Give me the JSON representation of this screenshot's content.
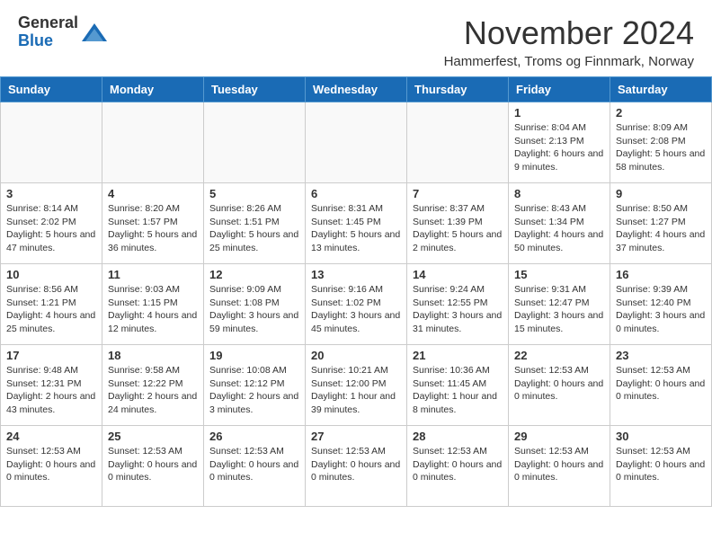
{
  "logo": {
    "general": "General",
    "blue": "Blue"
  },
  "title": "November 2024",
  "location": "Hammerfest, Troms og Finnmark, Norway",
  "headers": [
    "Sunday",
    "Monday",
    "Tuesday",
    "Wednesday",
    "Thursday",
    "Friday",
    "Saturday"
  ],
  "weeks": [
    [
      {
        "day": "",
        "info": "",
        "empty": true
      },
      {
        "day": "",
        "info": "",
        "empty": true
      },
      {
        "day": "",
        "info": "",
        "empty": true
      },
      {
        "day": "",
        "info": "",
        "empty": true
      },
      {
        "day": "",
        "info": "",
        "empty": true
      },
      {
        "day": "1",
        "info": "Sunrise: 8:04 AM\nSunset: 2:13 PM\nDaylight: 6 hours and 9 minutes."
      },
      {
        "day": "2",
        "info": "Sunrise: 8:09 AM\nSunset: 2:08 PM\nDaylight: 5 hours and 58 minutes."
      }
    ],
    [
      {
        "day": "3",
        "info": "Sunrise: 8:14 AM\nSunset: 2:02 PM\nDaylight: 5 hours and 47 minutes."
      },
      {
        "day": "4",
        "info": "Sunrise: 8:20 AM\nSunset: 1:57 PM\nDaylight: 5 hours and 36 minutes."
      },
      {
        "day": "5",
        "info": "Sunrise: 8:26 AM\nSunset: 1:51 PM\nDaylight: 5 hours and 25 minutes."
      },
      {
        "day": "6",
        "info": "Sunrise: 8:31 AM\nSunset: 1:45 PM\nDaylight: 5 hours and 13 minutes."
      },
      {
        "day": "7",
        "info": "Sunrise: 8:37 AM\nSunset: 1:39 PM\nDaylight: 5 hours and 2 minutes."
      },
      {
        "day": "8",
        "info": "Sunrise: 8:43 AM\nSunset: 1:34 PM\nDaylight: 4 hours and 50 minutes."
      },
      {
        "day": "9",
        "info": "Sunrise: 8:50 AM\nSunset: 1:27 PM\nDaylight: 4 hours and 37 minutes."
      }
    ],
    [
      {
        "day": "10",
        "info": "Sunrise: 8:56 AM\nSunset: 1:21 PM\nDaylight: 4 hours and 25 minutes."
      },
      {
        "day": "11",
        "info": "Sunrise: 9:03 AM\nSunset: 1:15 PM\nDaylight: 4 hours and 12 minutes."
      },
      {
        "day": "12",
        "info": "Sunrise: 9:09 AM\nSunset: 1:08 PM\nDaylight: 3 hours and 59 minutes."
      },
      {
        "day": "13",
        "info": "Sunrise: 9:16 AM\nSunset: 1:02 PM\nDaylight: 3 hours and 45 minutes."
      },
      {
        "day": "14",
        "info": "Sunrise: 9:24 AM\nSunset: 12:55 PM\nDaylight: 3 hours and 31 minutes."
      },
      {
        "day": "15",
        "info": "Sunrise: 9:31 AM\nSunset: 12:47 PM\nDaylight: 3 hours and 15 minutes."
      },
      {
        "day": "16",
        "info": "Sunrise: 9:39 AM\nSunset: 12:40 PM\nDaylight: 3 hours and 0 minutes."
      }
    ],
    [
      {
        "day": "17",
        "info": "Sunrise: 9:48 AM\nSunset: 12:31 PM\nDaylight: 2 hours and 43 minutes."
      },
      {
        "day": "18",
        "info": "Sunrise: 9:58 AM\nSunset: 12:22 PM\nDaylight: 2 hours and 24 minutes."
      },
      {
        "day": "19",
        "info": "Sunrise: 10:08 AM\nSunset: 12:12 PM\nDaylight: 2 hours and 3 minutes."
      },
      {
        "day": "20",
        "info": "Sunrise: 10:21 AM\nSunset: 12:00 PM\nDaylight: 1 hour and 39 minutes."
      },
      {
        "day": "21",
        "info": "Sunrise: 10:36 AM\nSunset: 11:45 AM\nDaylight: 1 hour and 8 minutes."
      },
      {
        "day": "22",
        "info": "Sunset: 12:53 AM\nDaylight: 0 hours and 0 minutes."
      },
      {
        "day": "23",
        "info": "Sunset: 12:53 AM\nDaylight: 0 hours and 0 minutes."
      }
    ],
    [
      {
        "day": "24",
        "info": "Sunset: 12:53 AM\nDaylight: 0 hours and 0 minutes."
      },
      {
        "day": "25",
        "info": "Sunset: 12:53 AM\nDaylight: 0 hours and 0 minutes."
      },
      {
        "day": "26",
        "info": "Sunset: 12:53 AM\nDaylight: 0 hours and 0 minutes."
      },
      {
        "day": "27",
        "info": "Sunset: 12:53 AM\nDaylight: 0 hours and 0 minutes."
      },
      {
        "day": "28",
        "info": "Sunset: 12:53 AM\nDaylight: 0 hours and 0 minutes."
      },
      {
        "day": "29",
        "info": "Sunset: 12:53 AM\nDaylight: 0 hours and 0 minutes."
      },
      {
        "day": "30",
        "info": "Sunset: 12:53 AM\nDaylight: 0 hours and 0 minutes."
      }
    ]
  ]
}
